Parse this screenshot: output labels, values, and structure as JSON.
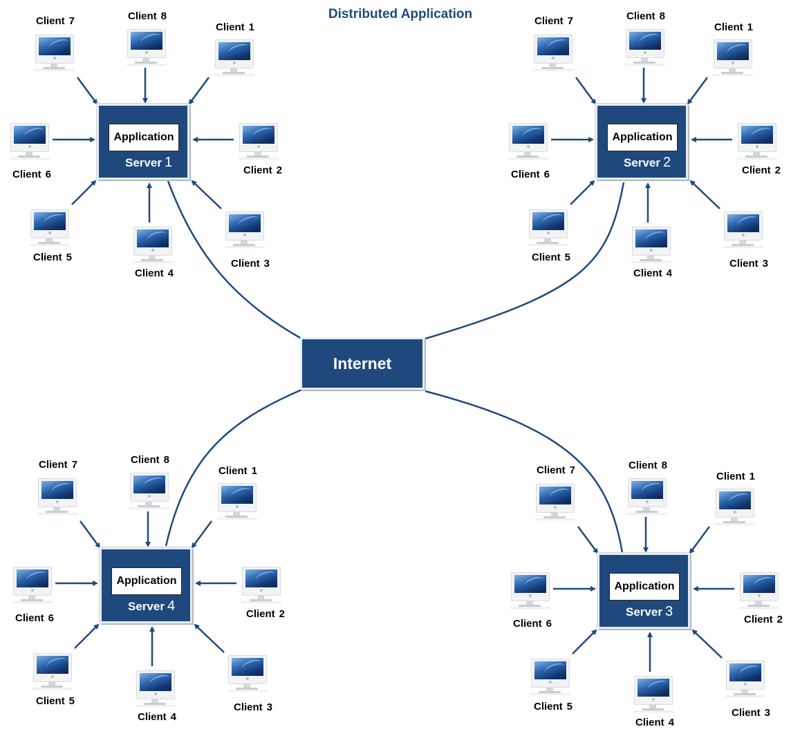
{
  "title": "Distributed Application",
  "internet": {
    "label": "Internet"
  },
  "colors": {
    "primary": "#1f497d",
    "background": "#ffffff",
    "text": "#000000"
  },
  "servers": [
    {
      "name": "Server",
      "number": "1",
      "application_label": "Application",
      "clients": [
        {
          "label": "Client",
          "number": "7"
        },
        {
          "label": "Client",
          "number": "8"
        },
        {
          "label": "Client",
          "number": "1"
        },
        {
          "label": "Client",
          "number": "6"
        },
        {
          "label": "Client",
          "number": "2"
        },
        {
          "label": "Client",
          "number": "5"
        },
        {
          "label": "Client",
          "number": "4"
        },
        {
          "label": "Client",
          "number": "3"
        }
      ]
    },
    {
      "name": "Server",
      "number": "2",
      "application_label": "Application",
      "clients": [
        {
          "label": "Client",
          "number": "7"
        },
        {
          "label": "Client",
          "number": "8"
        },
        {
          "label": "Client",
          "number": "1"
        },
        {
          "label": "Client",
          "number": "6"
        },
        {
          "label": "Client",
          "number": "2"
        },
        {
          "label": "Client",
          "number": "5"
        },
        {
          "label": "Client",
          "number": "4"
        },
        {
          "label": "Client",
          "number": "3"
        }
      ]
    },
    {
      "name": "Server",
      "number": "4",
      "application_label": "Application",
      "clients": [
        {
          "label": "Client",
          "number": "7"
        },
        {
          "label": "Client",
          "number": "8"
        },
        {
          "label": "Client",
          "number": "1"
        },
        {
          "label": "Client",
          "number": "6"
        },
        {
          "label": "Client",
          "number": "2"
        },
        {
          "label": "Client",
          "number": "5"
        },
        {
          "label": "Client",
          "number": "4"
        },
        {
          "label": "Client",
          "number": "3"
        }
      ]
    },
    {
      "name": "Server",
      "number": "3",
      "application_label": "Application",
      "clients": [
        {
          "label": "Client",
          "number": "7"
        },
        {
          "label": "Client",
          "number": "8"
        },
        {
          "label": "Client",
          "number": "1"
        },
        {
          "label": "Client",
          "number": "6"
        },
        {
          "label": "Client",
          "number": "2"
        },
        {
          "label": "Client",
          "number": "5"
        },
        {
          "label": "Client",
          "number": "4"
        },
        {
          "label": "Client",
          "number": "3"
        }
      ]
    }
  ],
  "connections": [
    {
      "from": "Internet",
      "to": "Server 1"
    },
    {
      "from": "Internet",
      "to": "Server 2"
    },
    {
      "from": "Internet",
      "to": "Server 4"
    },
    {
      "from": "Internet",
      "to": "Server 3"
    }
  ]
}
